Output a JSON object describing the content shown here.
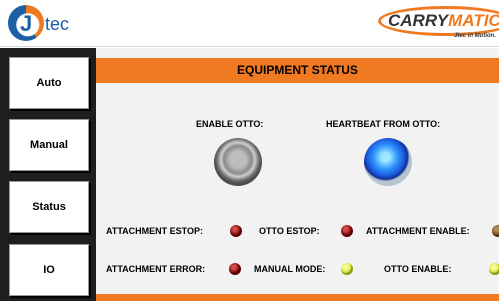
{
  "header": {
    "logo_left_text": "tec",
    "logo_left_letter": "J",
    "logo_right_carry": "CARRY",
    "logo_right_matic": "MATIC",
    "logo_right_tagline": "Jtec in Motion."
  },
  "sidebar": {
    "items": [
      {
        "label": "Auto"
      },
      {
        "label": "Manual"
      },
      {
        "label": "Status"
      },
      {
        "label": "IO"
      }
    ]
  },
  "main": {
    "title": "EQUIPMENT STATUS",
    "enable_otto_label": "ENABLE OTTO:",
    "heartbeat_label": "HEARTBEAT FROM OTTO:",
    "indicators": {
      "attachment_estop": "ATTACHMENT ESTOP:",
      "otto_estop": "OTTO ESTOP:",
      "attachment_enable": "ATTACHMENT ENABLE:",
      "attachment_error": "ATTACHMENT ERROR:",
      "manual_mode": "MANUAL MODE:",
      "otto_enable": "OTTO ENABLE:"
    }
  },
  "colors": {
    "accent": "#f07a22",
    "sidebar_bg": "#1e1e1e",
    "brand_blue": "#1d5fa6",
    "light_off_red": "#8a0f0f",
    "light_on_yellow": "#d7e23a",
    "heartbeat_blue": "#2f95ff",
    "enable_grey": "#8a8a8a"
  }
}
